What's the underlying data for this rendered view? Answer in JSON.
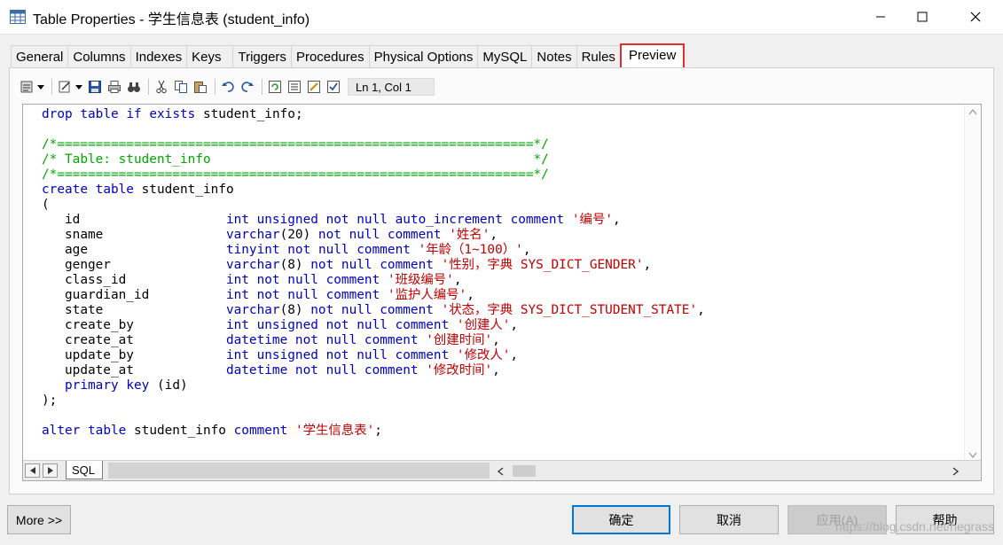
{
  "window": {
    "title": "Table Properties - 学生信息表 (student_info)"
  },
  "tabs": [
    {
      "label": "General"
    },
    {
      "label": "Columns"
    },
    {
      "label": "Indexes"
    },
    {
      "label": "Keys"
    },
    {
      "label": "Triggers"
    },
    {
      "label": "Procedures"
    },
    {
      "label": "Physical Options"
    },
    {
      "label": "MySQL"
    },
    {
      "label": "Notes"
    },
    {
      "label": "Rules"
    },
    {
      "label": "Preview",
      "active": true
    }
  ],
  "toolbar": {
    "cursor_position": "Ln 1, Col 1"
  },
  "editor": {
    "sheet_tab": "SQL",
    "lines": [
      "drop table if exists student_info;",
      "",
      "/*==============================================================*/",
      "/* Table: student_info                                          */",
      "/*==============================================================*/",
      "create table student_info",
      "(",
      "   id                   int unsigned not null auto_increment comment '编号',",
      "   sname                varchar(20) not null comment '姓名',",
      "   age                  tinyint not null comment '年龄（1~100）',",
      "   genger               varchar(8) not null comment '性别，字典 SYS_DICT_GENDER',",
      "   class_id             int not null comment '班级编号',",
      "   guardian_id          int not null comment '监护人编号',",
      "   state                varchar(8) not null comment '状态，字典 SYS_DICT_STUDENT_STATE',",
      "   create_by            int unsigned not null comment '创建人',",
      "   create_at            datetime not null comment '创建时间',",
      "   update_by            int unsigned not null comment '修改人',",
      "   update_at            datetime not null comment '修改时间',",
      "   primary key (id)",
      ");",
      "",
      "alter table student_info comment '学生信息表';"
    ]
  },
  "buttons": {
    "more": "More >>",
    "ok": "确定",
    "cancel": "取消",
    "apply": "应用(A)",
    "help": "帮助"
  },
  "watermark": "https://blog.csdn.net/hegrass",
  "colors": {
    "keyword": "#0000c0",
    "comment": "#00a800",
    "string": "#c00000",
    "active_tab_outline": "#e0302a"
  }
}
